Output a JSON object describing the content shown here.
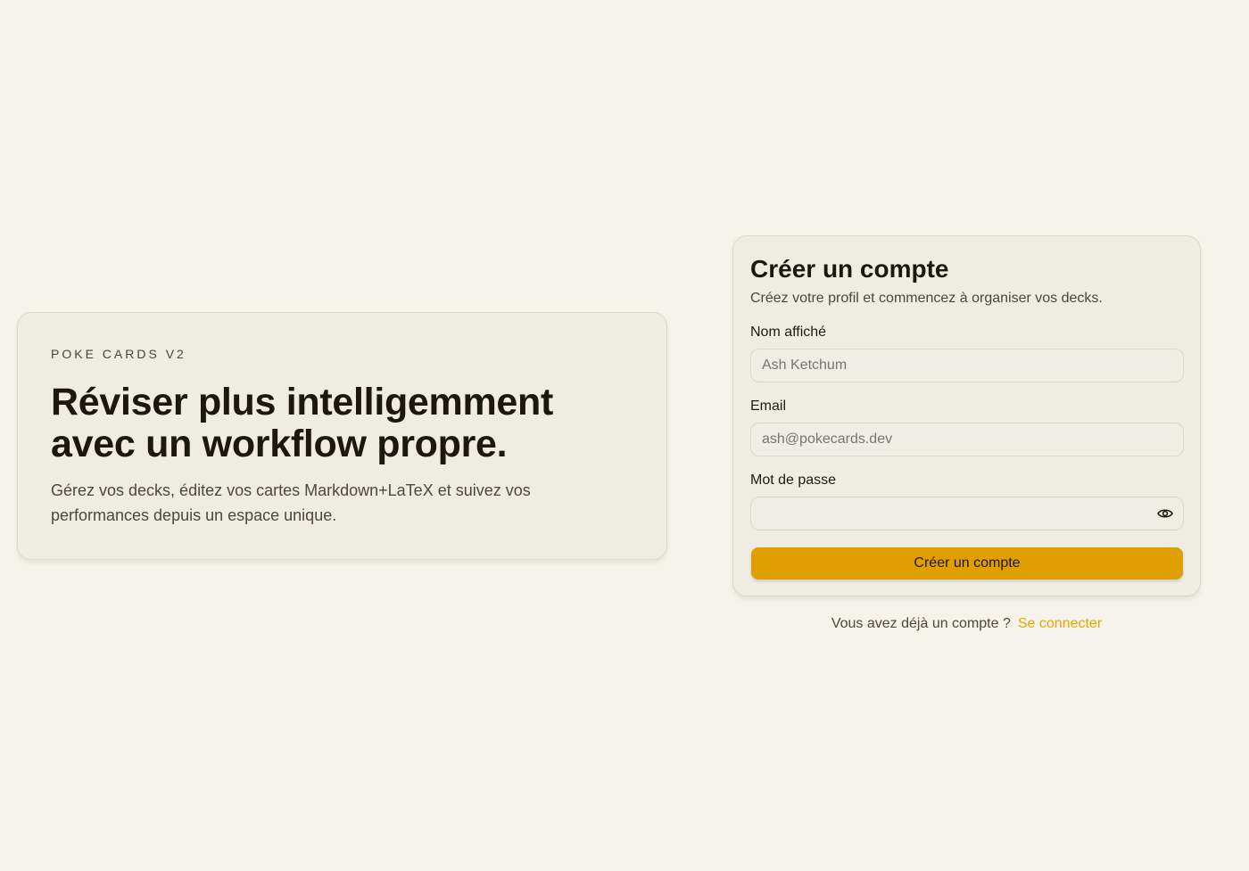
{
  "hero": {
    "eyebrow": "POKE CARDS V2",
    "title": "Réviser plus intelligemment avec un workflow propre.",
    "description": "Gérez vos decks, éditez vos cartes Markdown+LaTeX et suivez vos performances depuis un espace unique."
  },
  "form": {
    "title": "Créer un compte",
    "subtitle": "Créez votre profil et commencez à organiser vos decks.",
    "name_label": "Nom affiché",
    "name_placeholder": "Ash Ketchum",
    "email_label": "Email",
    "email_placeholder": "ash@pokecards.dev",
    "password_label": "Mot de passe",
    "password_value": "",
    "password_toggle_icon": "eye-icon",
    "submit_label": "Créer un compte"
  },
  "footer": {
    "prompt": "Vous avez déjà un compte ?",
    "login_link": "Se connecter"
  },
  "colors": {
    "background": "#f6f3ec",
    "card": "#efece4",
    "accent": "#e09f00",
    "link": "#e9a500"
  }
}
